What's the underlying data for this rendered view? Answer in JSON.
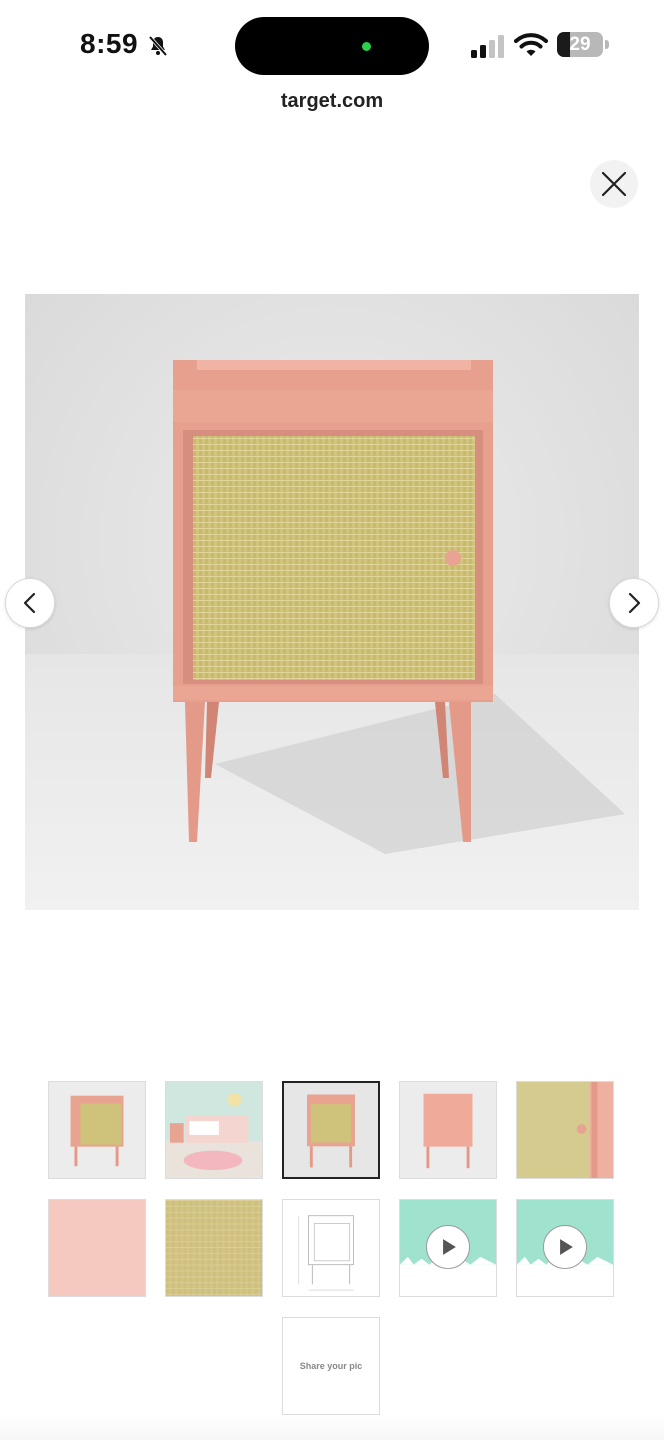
{
  "status_bar": {
    "time": "8:59",
    "battery_level": "29",
    "battery_fraction": 0.29
  },
  "browser": {
    "url": "target.com"
  },
  "gallery": {
    "close_icon": "close-icon",
    "prev_icon": "chevron-left-icon",
    "next_icon": "chevron-right-icon",
    "selected_index": 2,
    "thumbnails": [
      {
        "kind": "product-side"
      },
      {
        "kind": "room-scene"
      },
      {
        "kind": "product-front"
      },
      {
        "kind": "product-back"
      },
      {
        "kind": "rattan-closeup"
      },
      {
        "kind": "color-swatch"
      },
      {
        "kind": "rattan-texture"
      },
      {
        "kind": "dimension-drawing"
      },
      {
        "kind": "video",
        "icon": "play-icon"
      },
      {
        "kind": "video",
        "icon": "play-icon"
      },
      {
        "kind": "share",
        "label": "Share your pic"
      }
    ]
  },
  "colors": {
    "product_pink": "#e9a08f",
    "rattan": "#cfc27a",
    "swatch_pink": "#f5c8c0",
    "video_mint": "#9fe3cf"
  }
}
